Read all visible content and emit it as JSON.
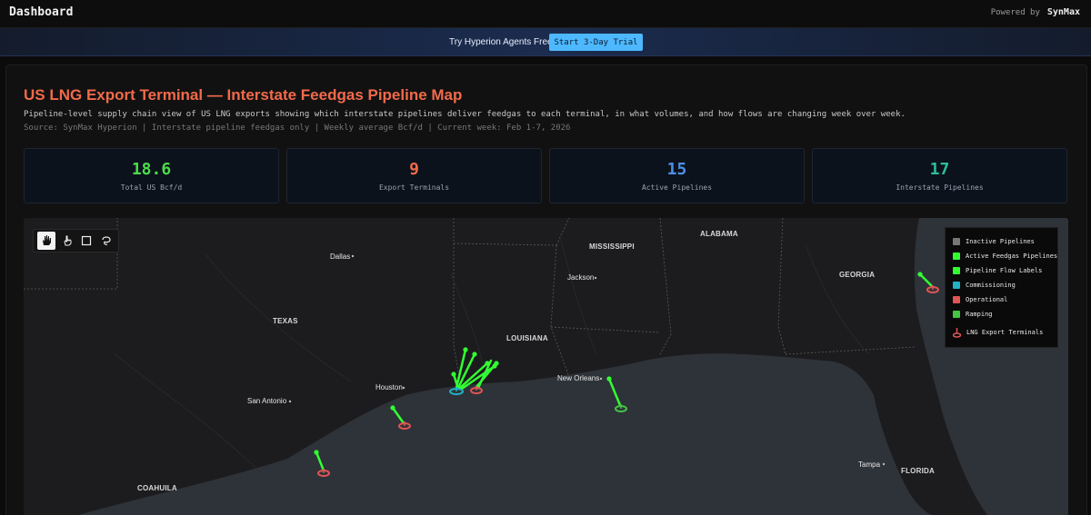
{
  "topbar": {
    "title": "Dashboard",
    "powered_label": "Powered by",
    "brand": "SynMax"
  },
  "banner": {
    "message": "Try Hyperion Agents Free",
    "cta_label": "Start 3-Day Trial"
  },
  "header": {
    "title": "US LNG Export Terminal — Interstate Feedgas Pipeline Map",
    "description": "Pipeline-level supply chain view of US LNG exports showing which interstate pipelines deliver feedgas to each terminal, in what volumes, and how flows are changing week over week.",
    "source": "Source: SynMax Hyperion | Interstate pipeline feedgas only | Weekly average Bcf/d | Current week: Feb 1-7, 2026"
  },
  "stats": [
    {
      "value": "18.6",
      "label": "Total US Bcf/d",
      "color": "#4cdb4c"
    },
    {
      "value": "9",
      "label": "Export Terminals",
      "color": "#f26a4b"
    },
    {
      "value": "15",
      "label": "Active Pipelines",
      "color": "#4e8fe8"
    },
    {
      "value": "17",
      "label": "Interstate Pipelines",
      "color": "#2bbf99"
    }
  ],
  "legend": {
    "items": [
      {
        "label": "Inactive Pipelines",
        "color": "#777777"
      },
      {
        "label": "Active Feedgas Pipelines",
        "color": "#33ff33"
      },
      {
        "label": "Pipeline Flow Labels",
        "color": "#33ff33"
      },
      {
        "label": "Commissioning",
        "color": "#1fb3c4"
      },
      {
        "label": "Operational",
        "color": "#e05555"
      },
      {
        "label": "Ramping",
        "color": "#44c444"
      }
    ],
    "terminal_label": "LNG Export Terminals"
  },
  "map": {
    "states": [
      {
        "name": "MISSISSIPPI"
      },
      {
        "name": "ALABAMA"
      },
      {
        "name": "GEORGIA"
      },
      {
        "name": "TEXAS"
      },
      {
        "name": "LOUISIANA"
      },
      {
        "name": "FLORIDA"
      },
      {
        "name": "COAHUILA"
      }
    ],
    "cities": [
      {
        "name": "Dallas"
      },
      {
        "name": "Jackson"
      },
      {
        "name": "Houston"
      },
      {
        "name": "San Antonio"
      },
      {
        "name": "New Orleans"
      },
      {
        "name": "Tampa"
      }
    ]
  },
  "colors": {
    "land": "#1c1c1e",
    "water": "#2e3339",
    "accent": "#4db8ff"
  },
  "icons": [
    "pan-hand-icon",
    "pointer-hand-icon",
    "box-select-icon",
    "lasso-icon",
    "terminal-marker-icon"
  ]
}
